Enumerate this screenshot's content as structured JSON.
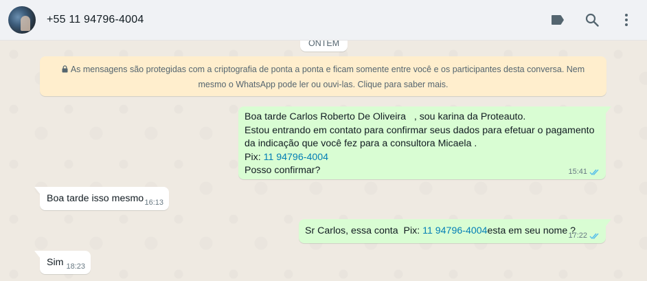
{
  "header": {
    "contact_name": "+55 11 94796-4004",
    "icons": [
      "label-icon",
      "search-icon",
      "menu-icon"
    ]
  },
  "chat": {
    "date_chip": "ONTEM",
    "encryption_notice": {
      "text": "As mensagens são protegidas com a criptografia de ponta a ponta e ficam somente entre você e os participantes desta conversa. Nem mesmo o WhatsApp pode ler ou ouvi-las. Clique para saber mais.",
      "icon": "lock-icon"
    },
    "messages": [
      {
        "direction": "outgoing",
        "line1": "Boa tarde Carlos Roberto De Oliveira   , sou karina da Proteauto.",
        "line2": "Estou entrando em contato para confirmar seus dados para efetuar o pagamento",
        "line3": "da indicação que você fez para a consultora Micaela .",
        "pix_label": "Pix: ",
        "pix_link": "11 94796-4004",
        "line5": "Posso confirmar?",
        "time": "15:41",
        "status": "read"
      },
      {
        "direction": "incoming",
        "text": "Boa tarde isso mesmo",
        "time": "16:13"
      },
      {
        "direction": "outgoing",
        "text_before": "Sr Carlos, essa conta  Pix: ",
        "link": "11 94796-4004",
        "text_after": "esta em seu nome ?",
        "time": "17:22",
        "status": "read"
      },
      {
        "direction": "incoming",
        "text": "Sim",
        "time": "18:23"
      }
    ]
  },
  "colors": {
    "outgoing_bubble": "#d9fdd3",
    "incoming_bubble": "#ffffff",
    "notice_bg": "#ffeecd",
    "link": "#027eb5",
    "read_ticks": "#53bdeb"
  }
}
